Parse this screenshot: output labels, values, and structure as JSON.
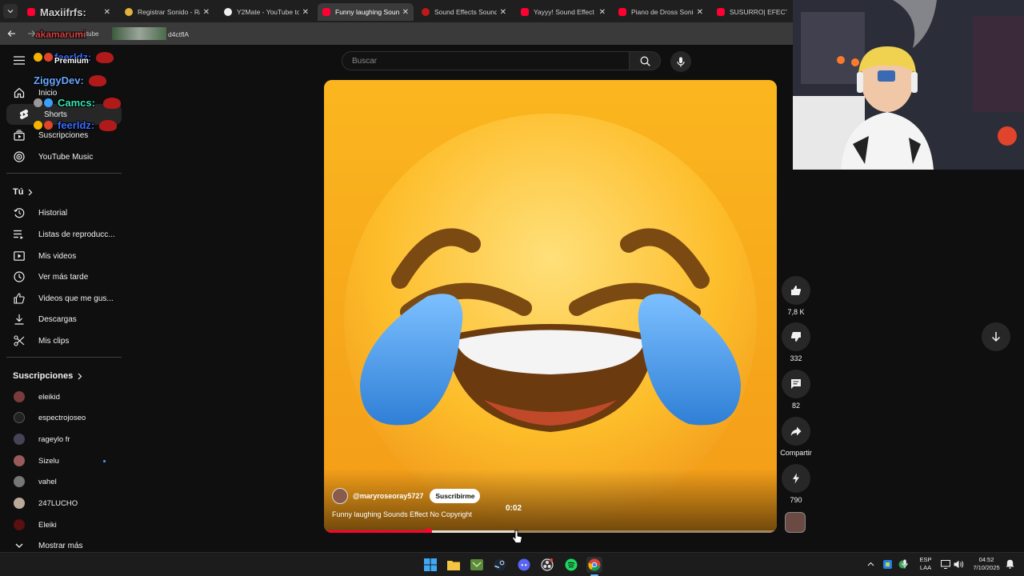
{
  "browser": {
    "tabs": [
      {
        "label": "Maxiifrfs:",
        "active": false
      },
      {
        "label": "Registrar Sonido - Ra",
        "active": false
      },
      {
        "label": "Y2Mate - YouTube to",
        "active": false
      },
      {
        "label": "Funny laughing Soun",
        "active": true
      },
      {
        "label": "Sound Effects Sound",
        "active": false
      },
      {
        "label": "Yayyy! Sound Effect -",
        "active": false
      },
      {
        "label": "Piano de Dross Sonid",
        "active": false
      },
      {
        "label": "SUSURRO| EFECTO D",
        "active": false
      }
    ],
    "address_fragment": "d4ctflA",
    "address_prefix": "youtube"
  },
  "chat": [
    {
      "user": "feerldz:",
      "color": "#3b6cff"
    },
    {
      "user": "ZiggyDev:",
      "color": "#6aa8ff"
    },
    {
      "user": "Camcs:",
      "color": "#37e6b5"
    },
    {
      "user": "feerldz:",
      "color": "#3b6cff"
    }
  ],
  "chat_extra": {
    "top_name": "akamarumi",
    "premium_label": "Premium"
  },
  "sidebar": {
    "main": [
      {
        "label": "Inicio",
        "icon": "home-icon"
      },
      {
        "label": "Shorts",
        "icon": "shorts-icon",
        "selected": true
      },
      {
        "label": "Suscripciones",
        "icon": "subscriptions-icon"
      },
      {
        "label": "YouTube Music",
        "icon": "music-icon"
      }
    ],
    "you_title": "Tú",
    "you": [
      {
        "label": "Historial",
        "icon": "history-icon"
      },
      {
        "label": "Listas de reproducc...",
        "icon": "playlist-icon"
      },
      {
        "label": "Mis videos",
        "icon": "my-videos-icon"
      },
      {
        "label": "Ver más tarde",
        "icon": "watch-later-icon"
      },
      {
        "label": "Videos que me gus...",
        "icon": "liked-icon"
      },
      {
        "label": "Descargas",
        "icon": "download-icon"
      },
      {
        "label": "Mis clips",
        "icon": "clips-icon"
      }
    ],
    "subs_title": "Suscripciones",
    "subs": [
      {
        "label": "eleikid",
        "avatar_color": "#7b3b3b",
        "live": false
      },
      {
        "label": "espectrojoseo",
        "avatar_color": "#222222",
        "live": false
      },
      {
        "label": "rageylo fr",
        "avatar_color": "#444455",
        "live": false
      },
      {
        "label": "Sizelu",
        "avatar_color": "#9a5a5a",
        "live": true
      },
      {
        "label": "vahel",
        "avatar_color": "#777777",
        "live": false
      },
      {
        "label": "247LUCHO",
        "avatar_color": "#bbaa99",
        "live": false
      },
      {
        "label": "Eleiki",
        "avatar_color": "#5a1010",
        "live": false
      }
    ],
    "show_more": "Mostrar más"
  },
  "search": {
    "placeholder": "Buscar"
  },
  "video": {
    "channel": "@maryroseoray5727",
    "subscribe": "Suscribirme",
    "title": "Funny laughing Sounds Effect No Copyright",
    "time": "0:02",
    "progress": 0.23,
    "hover": 0.42
  },
  "actions": {
    "likes": "7,8 K",
    "dislikes": "332",
    "comments": "82",
    "share": "Compartir",
    "remix": "790"
  },
  "taskbar": {
    "lang_top": "ESP",
    "lang_bottom": "LAA",
    "time": "04:52",
    "date": "7/10/2025"
  },
  "colors": {
    "accent": "#ff0033",
    "emoji": "#fbb01f",
    "tear": "#3c8ee0"
  }
}
